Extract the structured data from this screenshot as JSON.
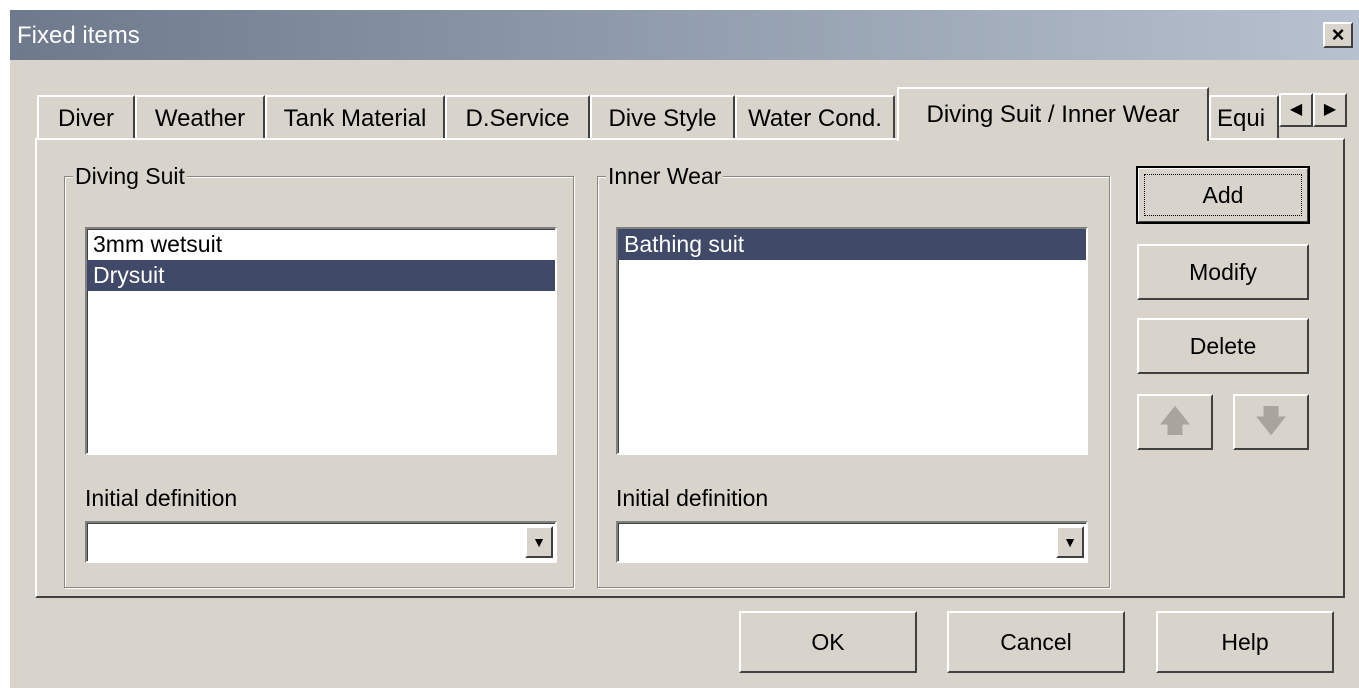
{
  "window": {
    "title": "Fixed items",
    "close_label": "×"
  },
  "tabs": [
    {
      "label": "Diver"
    },
    {
      "label": "Weather"
    },
    {
      "label": "Tank Material"
    },
    {
      "label": "D.Service"
    },
    {
      "label": "Dive Style"
    },
    {
      "label": "Water Cond."
    },
    {
      "label": "Diving Suit / Inner Wear"
    },
    {
      "label": "Equi"
    }
  ],
  "active_tab": "Diving Suit / Inner Wear",
  "tab_scroll": {
    "left_icon": "◀",
    "right_icon": "▶"
  },
  "diving_suit": {
    "group_label": "Diving Suit",
    "items": [
      "3mm wetsuit",
      "Drysuit"
    ],
    "selected": "Drysuit",
    "initial_label": "Initial definition",
    "initial_value": ""
  },
  "inner_wear": {
    "group_label": "Inner Wear",
    "items": [
      "Bathing suit"
    ],
    "selected": "Bathing suit",
    "initial_label": "Initial definition",
    "initial_value": ""
  },
  "actions": {
    "add": "Add",
    "modify": "Modify",
    "delete": "Delete",
    "up_icon": "🡅",
    "down_icon": "🡇"
  },
  "footer": {
    "ok": "OK",
    "cancel": "Cancel",
    "help": "Help"
  },
  "combo_arrow": "▼",
  "colors": {
    "selection": "#404a68",
    "face": "#d8d3cb"
  }
}
